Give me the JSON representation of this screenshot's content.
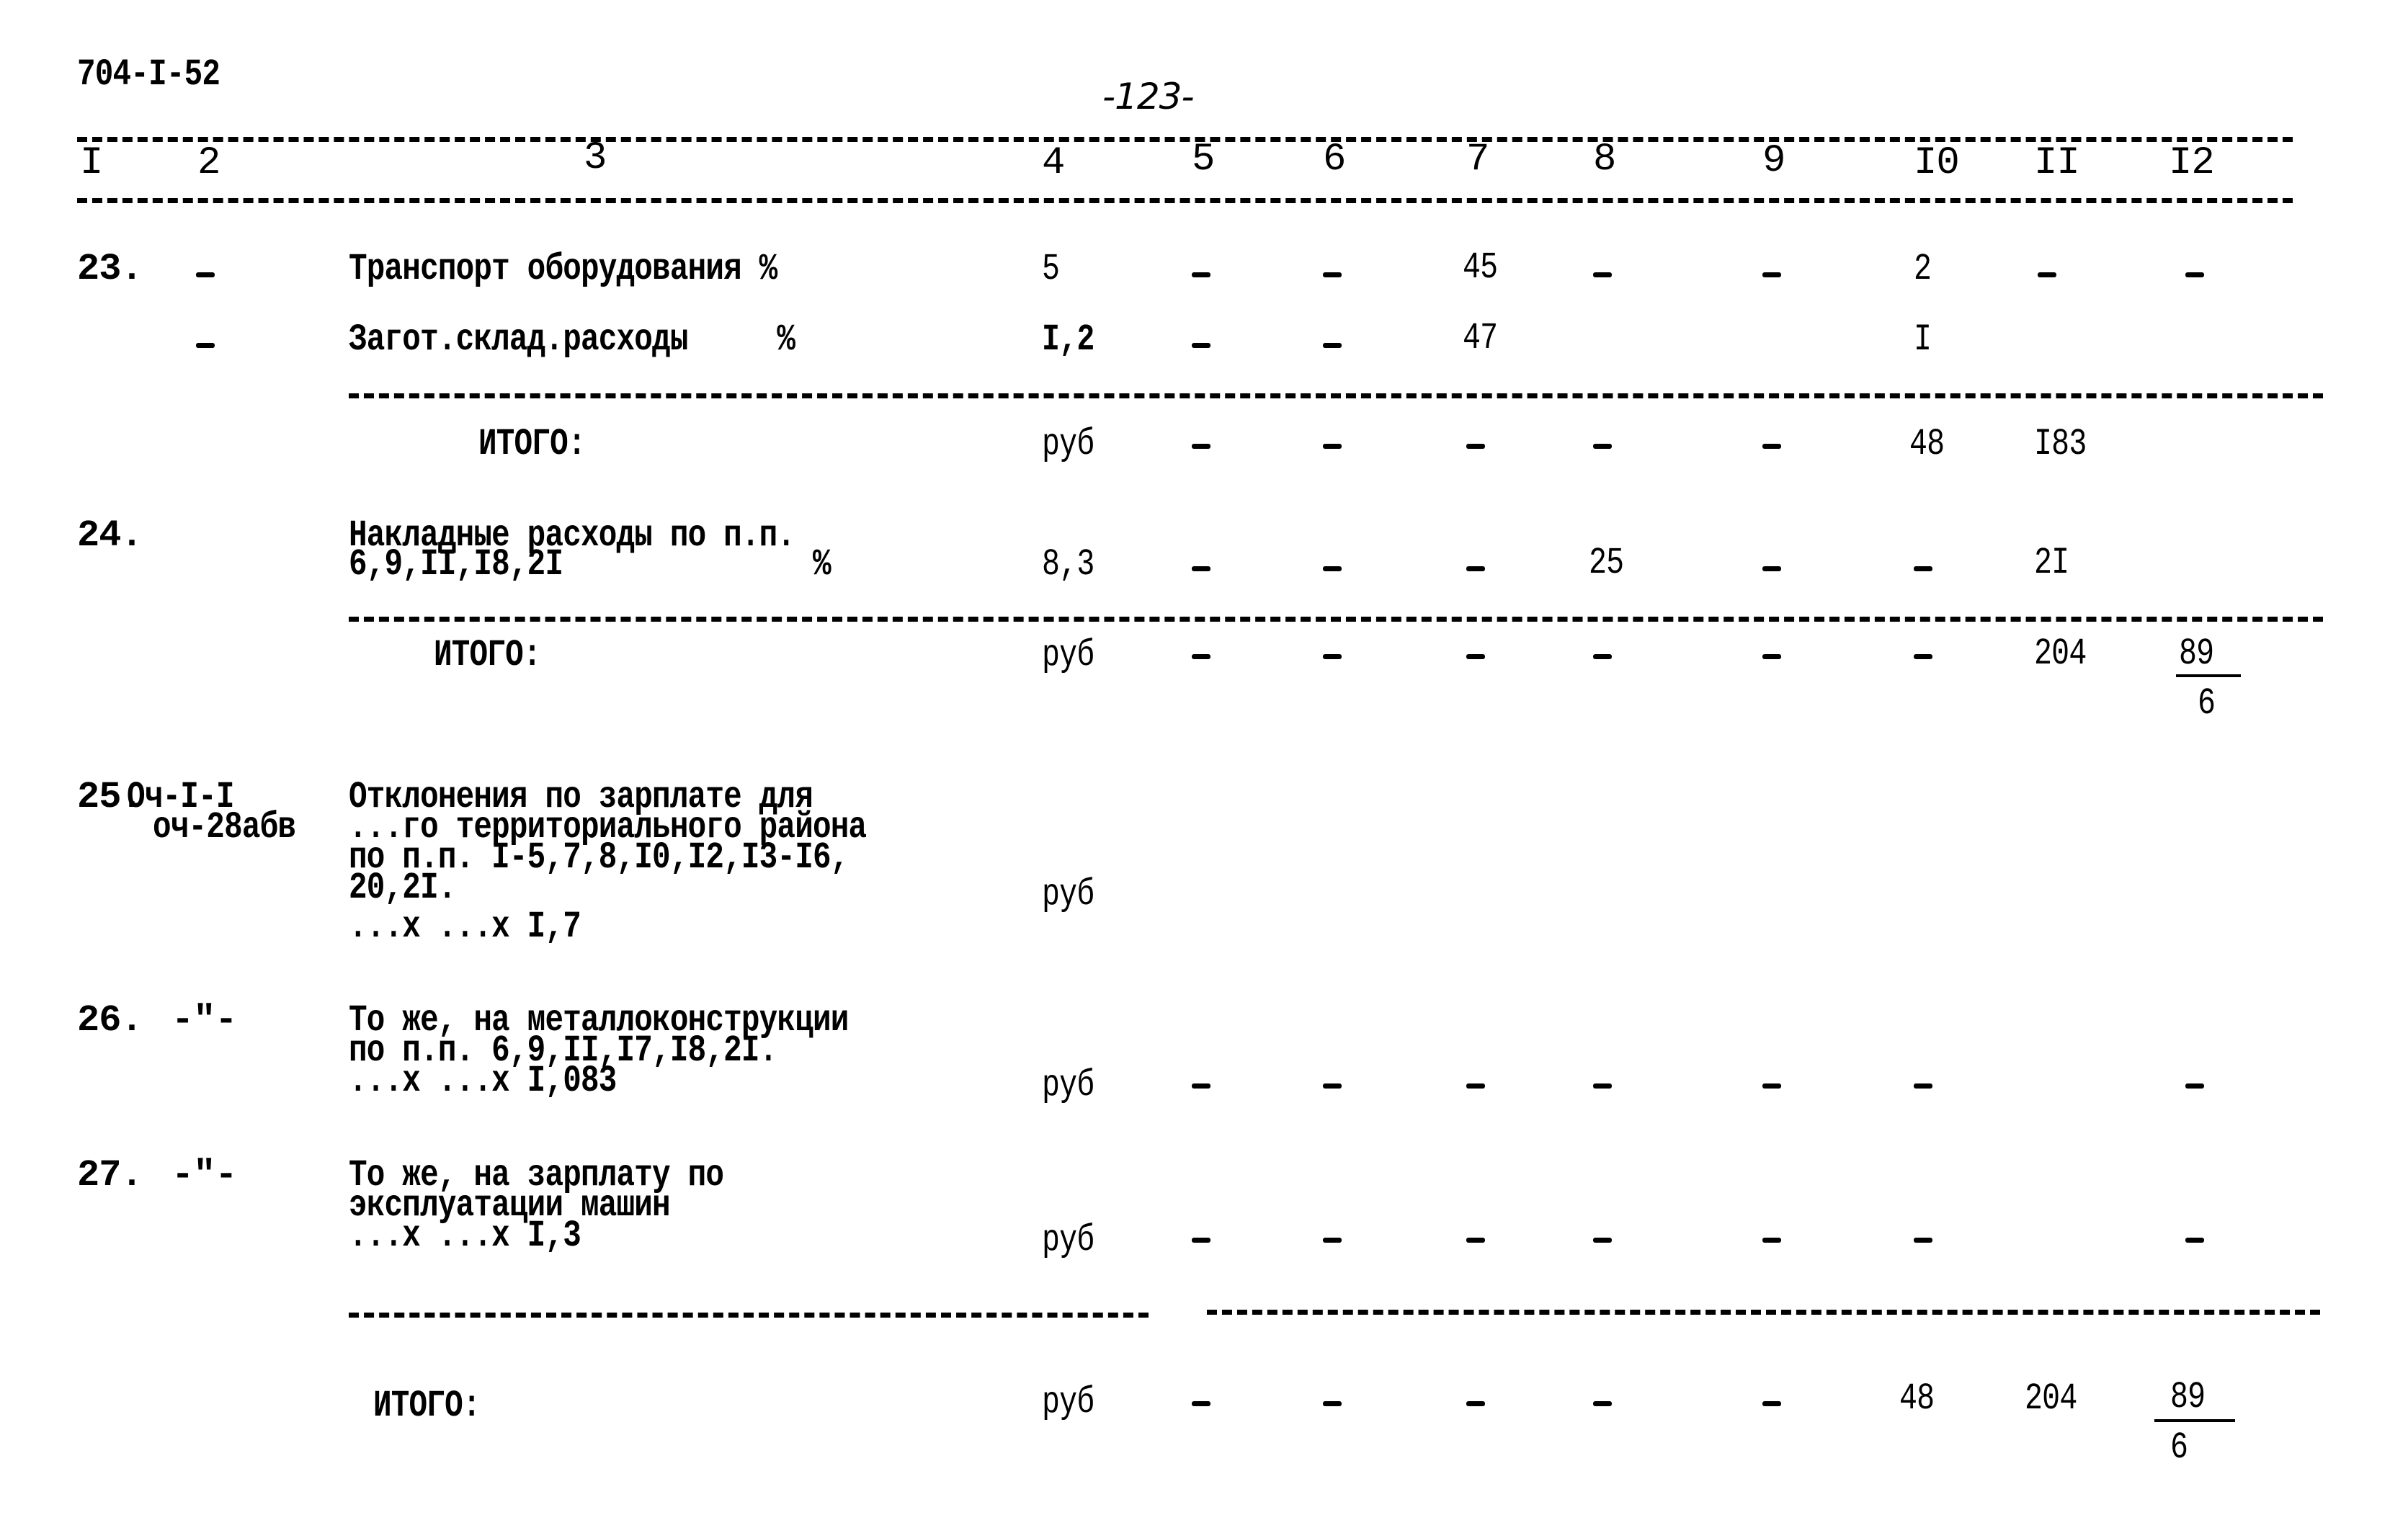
{
  "document": {
    "code": "704-I-52",
    "page_number": "-123-"
  },
  "header": [
    "I",
    "2",
    "3",
    "4",
    "5",
    "6",
    "7",
    "8",
    "9",
    "I0",
    "II",
    "I2"
  ],
  "rows": [
    {
      "num": "23.",
      "code": "-",
      "desc": [
        "Транспорт оборудования %"
      ],
      "c4": "5",
      "c5": "-",
      "c6": "-",
      "c7": "45",
      "c8": "-",
      "c9": "-",
      "c10": "2",
      "c11": "-",
      "c12": "-"
    },
    {
      "num": "",
      "code": "-",
      "desc": [
        "Загот.склад.расходы     %"
      ],
      "c4": "I,2",
      "c5": "-",
      "c6": "-",
      "c7": "47",
      "c8": "",
      "c9": "",
      "c10": "I",
      "c11": "",
      "c12": ""
    },
    {
      "type": "total",
      "label": "ИТОГО:",
      "c4": "руб",
      "c5": "-",
      "c6": "-",
      "c7": "-",
      "c8": "-",
      "c9": "-",
      "c10": "48",
      "c11": "I83",
      "c12": ""
    },
    {
      "num": "24.",
      "code": "",
      "desc": [
        "Накладные расходы по п.п.",
        "6,9,II,I8,2I              %"
      ],
      "c4": "8,3",
      "c5": "-",
      "c6": "-",
      "c7": "-",
      "c8": "25",
      "c9": "-",
      "c10": "-",
      "c11": "2I",
      "c12": ""
    },
    {
      "type": "total",
      "label": "ИТОГО:",
      "c4": "руб",
      "c5": "-",
      "c6": "-",
      "c7": "-",
      "c8": "-",
      "c9": "-",
      "c10": "-",
      "c11": "204",
      "c12_fraction": {
        "numerator": "89",
        "denominator": "6"
      }
    },
    {
      "num": "25.",
      "code": [
        "Оч-I-I",
        "оч-28абв"
      ],
      "desc": [
        "Отклонения по зарплате для",
        "...го территориального района",
        "по п.п. I-5,7,8,I0,I2,I3-I6,",
        "20,2I.",
        "...х ...х I,7"
      ],
      "c4": "руб"
    },
    {
      "num": "26.",
      "code": "-\"-",
      "desc": [
        "То же, на металлоконструкции",
        "по п.п. 6,9,II,I7,I8,2I.",
        "...х ...х I,083"
      ],
      "c4": "руб",
      "c5": "-",
      "c6": "-",
      "c7": "-",
      "c8": "-",
      "c9": "-",
      "c10": "-",
      "c11": "",
      "c12": "-"
    },
    {
      "num": "27.",
      "code": "-\"-",
      "desc": [
        "То же, на зарплату по",
        "эксплуатации машин",
        "...х ...х I,3"
      ],
      "c4": "руб",
      "c5": "-",
      "c6": "-",
      "c7": "-",
      "c8": "-",
      "c9": "-",
      "c10": "-",
      "c11": "",
      "c12": "-"
    },
    {
      "type": "total",
      "label": "ИТОГО:",
      "c4": "руб",
      "c5": "-",
      "c6": "-",
      "c7": "-",
      "c8": "-",
      "c9": "-",
      "c10": "48",
      "c11": "204",
      "c12_fraction": {
        "numerator": "89",
        "denominator": "6"
      }
    }
  ]
}
